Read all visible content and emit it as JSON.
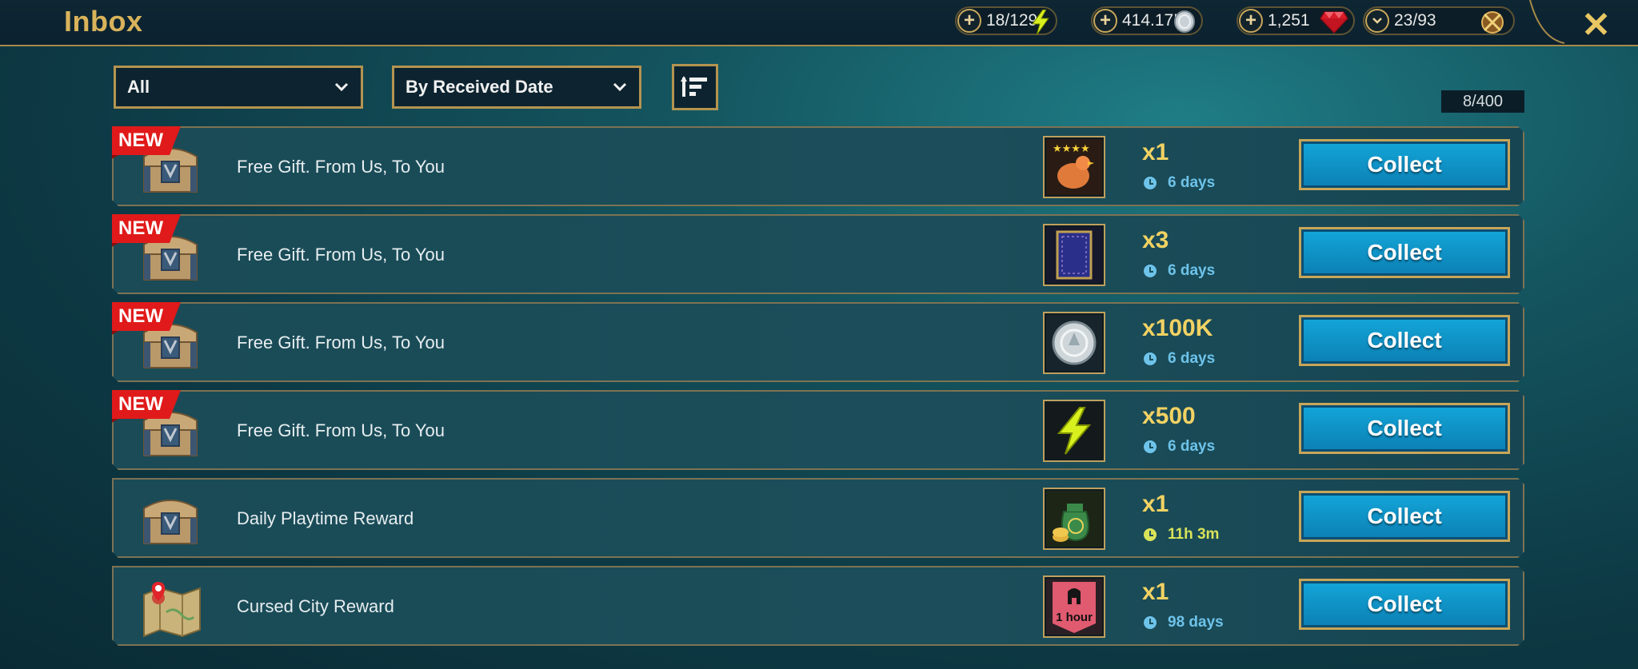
{
  "header": {
    "title": "Inbox",
    "resources": [
      {
        "value": "18/129",
        "icon": "energy-bolt-icon",
        "button": "plus"
      },
      {
        "value": "414.17K",
        "icon": "silver-coin-icon",
        "button": "plus"
      },
      {
        "value": "1,251",
        "icon": "ruby-gem-icon",
        "button": "plus"
      },
      {
        "value": "23/93",
        "icon": "arena-key-icon",
        "button": "chevron-down"
      }
    ],
    "close_glyph": "✕"
  },
  "filters": {
    "category": "All",
    "sort_by": "By Received Date",
    "sort_order_icon": "sort-descending-icon",
    "message_count": "8/400"
  },
  "new_label": "NEW",
  "collect_label": "Collect",
  "messages": [
    {
      "title": "Free Gift. From Us, To You",
      "is_new": true,
      "icon": "chest-icon",
      "item_icon": "chicken-food-icon",
      "quantity": "x1",
      "time_left": "6 days"
    },
    {
      "title": "Free Gift. From Us, To You",
      "is_new": true,
      "icon": "chest-icon",
      "item_icon": "tome-icon",
      "quantity": "x3",
      "time_left": "6 days"
    },
    {
      "title": "Free Gift. From Us, To You",
      "is_new": true,
      "icon": "chest-icon",
      "item_icon": "silver-coin-icon",
      "quantity": "x100K",
      "time_left": "6 days"
    },
    {
      "title": "Free Gift. From Us, To You",
      "is_new": true,
      "icon": "chest-icon",
      "item_icon": "energy-bolt-icon",
      "quantity": "x500",
      "time_left": "6 days"
    },
    {
      "title": "Daily Playtime Reward",
      "is_new": false,
      "icon": "chest-icon",
      "item_icon": "money-bag-icon",
      "quantity": "x1",
      "time_left": "11h 3m"
    },
    {
      "title": "Cursed City Reward",
      "is_new": false,
      "icon": "map-scroll-icon",
      "item_icon": "boost-banner-icon",
      "item_label": "1 hour",
      "quantity": "x1",
      "time_left": "98 days"
    }
  ],
  "colors": {
    "accent_gold": "#d9b35b",
    "collect_button": "#0f95c8",
    "time_blue": "#6ec3ea",
    "time_yellow": "#d9e35a",
    "new_badge": "#e01a1a"
  }
}
